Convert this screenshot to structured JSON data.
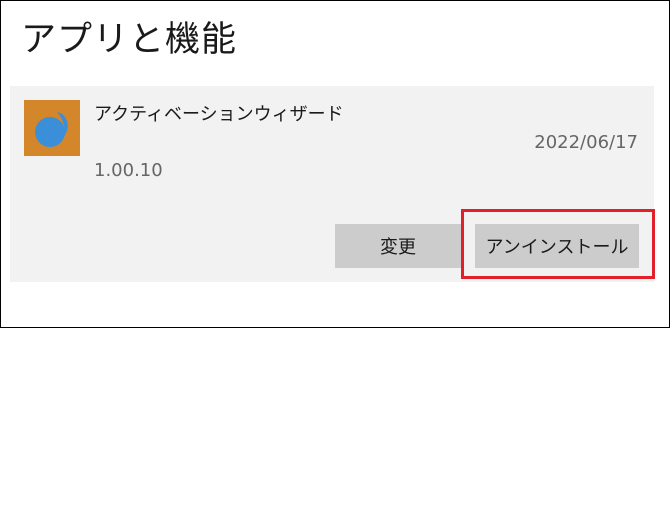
{
  "page": {
    "title": "アプリと機能"
  },
  "app": {
    "name": "アクティベーションウィザード",
    "date": "2022/06/17",
    "version": "1.00.10",
    "icon": "app-logo-icon",
    "icon_bg_color": "#d4862a",
    "icon_fg_color": "#3a8fd8"
  },
  "actions": {
    "modify_label": "変更",
    "uninstall_label": "アンインストール"
  },
  "highlight": {
    "color": "#e3202a",
    "target": "uninstall-button"
  }
}
